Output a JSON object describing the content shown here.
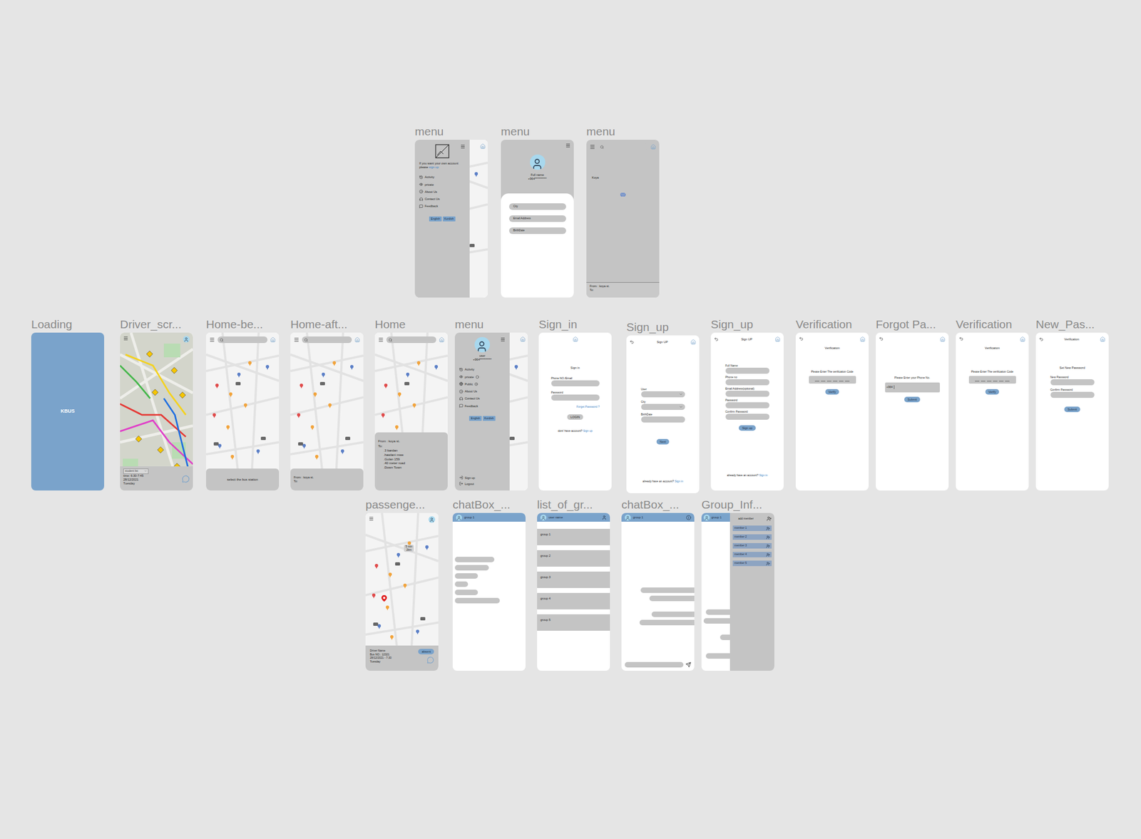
{
  "frames": [
    {
      "label": "menu",
      "kind": "guest-menu",
      "prompt": "If you want your own account please",
      "link": "sign up",
      "items": [
        {
          "label": "Activity",
          "kind": "link"
        },
        {
          "label": "private",
          "kind": "link"
        },
        {
          "label": "About Us",
          "kind": "link"
        },
        {
          "label": "Contact Us",
          "kind": "link"
        },
        {
          "label": "Feedback",
          "kind": "link"
        }
      ],
      "languages": [
        "English",
        "Kurdish"
      ]
    },
    {
      "label": "menu",
      "kind": "profile",
      "name": "Full name",
      "phone": "+964**********",
      "fields": [
        "City",
        "Email Address",
        "BirthDate"
      ]
    },
    {
      "label": "menu",
      "kind": "search-result",
      "result": "Koya",
      "from": "From : koya st.",
      "to": "To:"
    },
    {
      "label": "Loading",
      "kind": "loading",
      "logo": "KBUS"
    },
    {
      "label": "Driver_scr...",
      "kind": "driver",
      "select": "student list",
      "time": "time: 6:30-7:45",
      "date": "28/12/2021",
      "day": "Tuesday"
    },
    {
      "label": "Home-be...",
      "kind": "home-before",
      "prompt": "select the bus station"
    },
    {
      "label": "Home-aft...",
      "kind": "home-after",
      "from": "From : koya st.",
      "to": "To:"
    },
    {
      "label": "Home",
      "kind": "home",
      "from": "From : koya st.",
      "to": "To:",
      "stops": [
        ".3 bardan",
        ".hawlani mwe",
        ".Gulan 159",
        ".40 meter road",
        ".Down Town"
      ]
    },
    {
      "label": "menu",
      "kind": "user-menu",
      "name": "user",
      "phone": "+964**********",
      "items": [
        {
          "label": "Activity",
          "kind": "link"
        },
        {
          "label": "private",
          "kind": "radio",
          "selected": false
        },
        {
          "label": "Public",
          "kind": "radio",
          "selected": true
        },
        {
          "label": "About Us",
          "kind": "link"
        },
        {
          "label": "Contact Us",
          "kind": "link"
        },
        {
          "label": "Feedback",
          "kind": "link"
        }
      ],
      "languages": [
        "English",
        "Kurdish"
      ],
      "footer": [
        "Sign up",
        "Logout"
      ]
    },
    {
      "label": "Sign_in",
      "kind": "sign-in",
      "title": "Sign in",
      "fields": [
        "Phone NO./Email",
        "Password"
      ],
      "forgot": "Forget Password ?",
      "button": "LOGIN",
      "prompt": "dont' have account?",
      "link": "Sign up"
    },
    {
      "label": "Sign_up",
      "kind": "signup-details",
      "title": "Sign UP",
      "fields": [
        {
          "label": "User",
          "kind": "select"
        },
        {
          "label": "City",
          "kind": "select"
        },
        {
          "label": "BirthDate",
          "kind": "input"
        }
      ],
      "button": "Next",
      "prompt": "already have an account?",
      "link": "Sign in"
    },
    {
      "label": "Sign_up",
      "kind": "signup-account",
      "title": "Sign UP",
      "fields": [
        "Full Name",
        "Phone no",
        "Email Address(optional)",
        "Password",
        "Confirm Password"
      ],
      "button": "Sign up",
      "prompt": "already have an account?",
      "link": "Sign in"
    },
    {
      "label": "Verification",
      "kind": "verify",
      "title": "Verification",
      "prompt": "Please Enter The verification Code",
      "button": "Verify"
    },
    {
      "label": "Forgot Pa...",
      "kind": "forgot",
      "prompt": "Please Enter your Phone No.",
      "prefix": "+964",
      "button": "Submit"
    },
    {
      "label": "Verification",
      "kind": "verify",
      "title": "Verification",
      "prompt": "Please Enter The verification Code",
      "button": "Verify"
    },
    {
      "label": "New_Pas...",
      "kind": "new-password",
      "title": "Verification",
      "heading": "Set New Password",
      "fields": [
        "New Password",
        "Confirm Password"
      ],
      "button": "Submit"
    },
    {
      "label": "passenge...",
      "kind": "passenger",
      "eta": [
        "5 min",
        "2km"
      ],
      "driver": "Driver Name",
      "bus": "Bus NO.: 12321",
      "date": "28/12/2021 - 7:30",
      "day": "Tuesday",
      "button": "absent"
    },
    {
      "label": "chatBox_...",
      "kind": "chat-in",
      "title": "group 1"
    },
    {
      "label": "list_of_gr...",
      "kind": "groups",
      "title": "user name",
      "groups": [
        "group 1",
        "group 2",
        "group 3",
        "group 4",
        "group 5"
      ]
    },
    {
      "label": "chatBox_...",
      "kind": "chat-out",
      "title": "group 1"
    },
    {
      "label": "Group_Inf...",
      "kind": "group-info",
      "title": "group 1",
      "panel": "add member",
      "members": [
        "member 1",
        "member 2",
        "member 3",
        "member 4",
        "member 5"
      ]
    }
  ]
}
